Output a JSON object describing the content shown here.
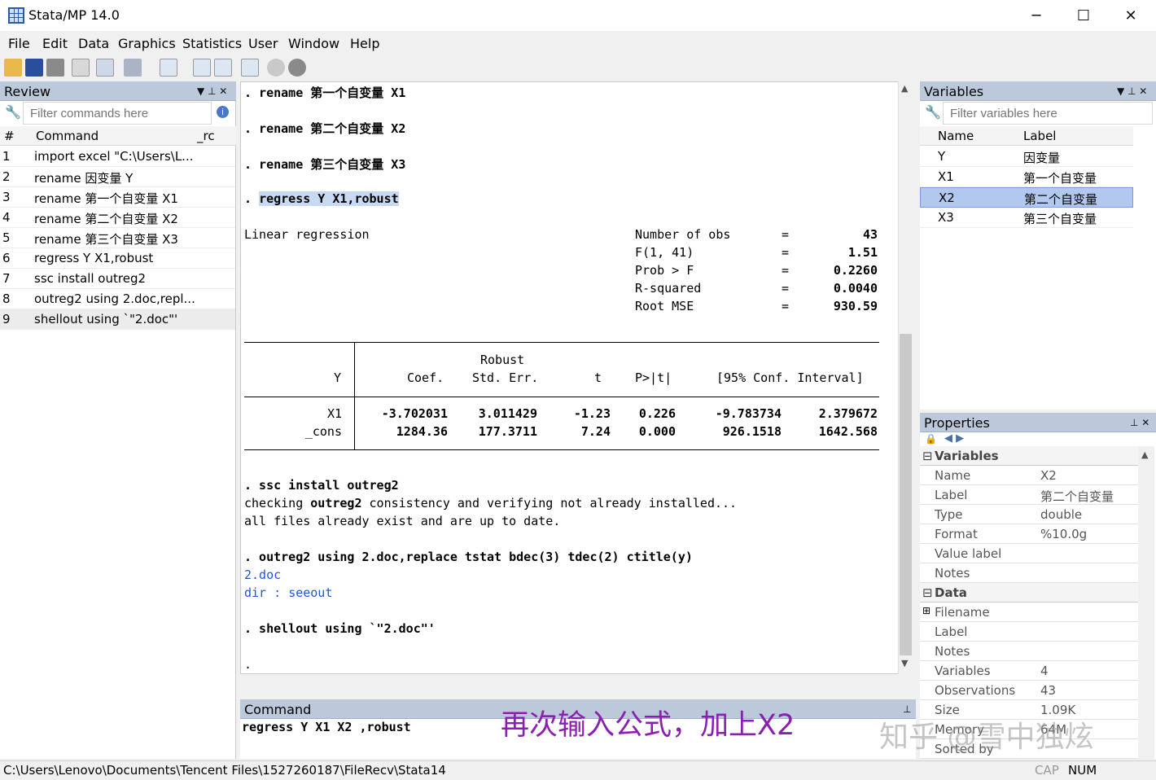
{
  "window": {
    "title": "Stata/MP 14.0",
    "minimize": "─",
    "maximize": "☐",
    "close": "✕"
  },
  "menu": [
    "File",
    "Edit",
    "Data",
    "Graphics",
    "Statistics",
    "User",
    "Window",
    "Help"
  ],
  "review": {
    "title": "Review",
    "filter_placeholder": "Filter commands here",
    "col_num": "#",
    "col_cmd": "Command",
    "col_rc": "_rc",
    "items": [
      {
        "n": "1",
        "cmd": "import excel \"C:\\Users\\L..."
      },
      {
        "n": "2",
        "cmd": "rename 因变量 Y"
      },
      {
        "n": "3",
        "cmd": "rename 第一个自变量 X1"
      },
      {
        "n": "4",
        "cmd": "rename 第二个自变量 X2"
      },
      {
        "n": "5",
        "cmd": "rename 第三个自变量 X3"
      },
      {
        "n": "6",
        "cmd": "regress Y X1,robust"
      },
      {
        "n": "7",
        "cmd": "ssc install outreg2"
      },
      {
        "n": "8",
        "cmd": "outreg2 using 2.doc,repl..."
      },
      {
        "n": "9",
        "cmd": "shellout using `\"2.doc\"'"
      }
    ]
  },
  "results": {
    "cmd1": ". rename 第一个自变量 X1",
    "cmd2": ". rename 第二个自变量 X2",
    "cmd3": ". rename 第三个自变量 X3",
    "cmd4_prefix": ". ",
    "cmd4": "regress Y X1,robust",
    "lr": "Linear regression",
    "stats": [
      {
        "k": "Number of obs",
        "v": "43"
      },
      {
        "k": "F(1, 41)",
        "v": "1.51"
      },
      {
        "k": "Prob > F",
        "v": "0.2260"
      },
      {
        "k": "R-squared",
        "v": "0.0040"
      },
      {
        "k": "Root MSE",
        "v": "930.59"
      }
    ],
    "eq": "=",
    "head_robust": "Robust",
    "head_y": "Y",
    "head_coef": "Coef.",
    "head_se": "Std. Err.",
    "head_t": "t",
    "head_p": "P>|t|",
    "head_ci": "[95% Conf. Interval]",
    "rows": [
      {
        "name": "X1",
        "coef": "-3.702031",
        "se": "3.011429",
        "t": "-1.23",
        "p": "0.226",
        "lo": "-9.783734",
        "hi": "2.379672"
      },
      {
        "name": "_cons",
        "coef": "1284.36",
        "se": "177.3711",
        "t": "7.24",
        "p": "0.000",
        "lo": "926.1518",
        "hi": "1642.568"
      }
    ],
    "cmd5": ". ssc install outreg2",
    "chk_a": "checking ",
    "chk_b": "outreg2",
    "chk_c": " consistency and verifying not already installed...",
    "allfiles": "all files already exist and are up to date.",
    "cmd6": ". outreg2 using 2.doc,replace tstat bdec(3) tdec(2) ctitle(y)",
    "link1": "2.doc",
    "dir_label": "dir : ",
    "link2": "seeout",
    "cmd7": ". shellout using `\"2.doc\"'",
    "prompt": "."
  },
  "command": {
    "title": "Command",
    "value": "regress Y X1 X2 ,robust"
  },
  "annotation": "再次输入公式，加上X2",
  "watermark": "知乎 @雪中独炫",
  "variables": {
    "title": "Variables",
    "filter_placeholder": "Filter variables here",
    "col_name": "Name",
    "col_label": "Label",
    "items": [
      {
        "name": "Y",
        "label": "因变量"
      },
      {
        "name": "X1",
        "label": "第一个自变量"
      },
      {
        "name": "X2",
        "label": "第二个自变量"
      },
      {
        "name": "X3",
        "label": "第三个自变量"
      }
    ]
  },
  "properties": {
    "title": "Properties",
    "sec_vars": "Variables",
    "vars": [
      {
        "k": "Name",
        "v": "X2"
      },
      {
        "k": "Label",
        "v": "第二个自变量"
      },
      {
        "k": "Type",
        "v": "double"
      },
      {
        "k": "Format",
        "v": "%10.0g"
      },
      {
        "k": "Value label",
        "v": ""
      },
      {
        "k": "Notes",
        "v": ""
      }
    ],
    "sec_data": "Data",
    "data": [
      {
        "k": "Filename",
        "v": ""
      },
      {
        "k": "Label",
        "v": ""
      },
      {
        "k": "Notes",
        "v": ""
      },
      {
        "k": "Variables",
        "v": "4"
      },
      {
        "k": "Observations",
        "v": "43"
      },
      {
        "k": "Size",
        "v": "1.09K"
      },
      {
        "k": "Memory",
        "v": "64M"
      },
      {
        "k": "Sorted by",
        "v": ""
      }
    ]
  },
  "status": {
    "path": "C:\\Users\\Lenovo\\Documents\\Tencent Files\\1527260187\\FileRecv\\Stata14",
    "cap": "CAP",
    "num": "NUM"
  },
  "colors": {
    "accent": "#bcc9db",
    "selection": "#b3c8ee",
    "annotation": "#8a1fb0",
    "link": "#2155d8"
  }
}
